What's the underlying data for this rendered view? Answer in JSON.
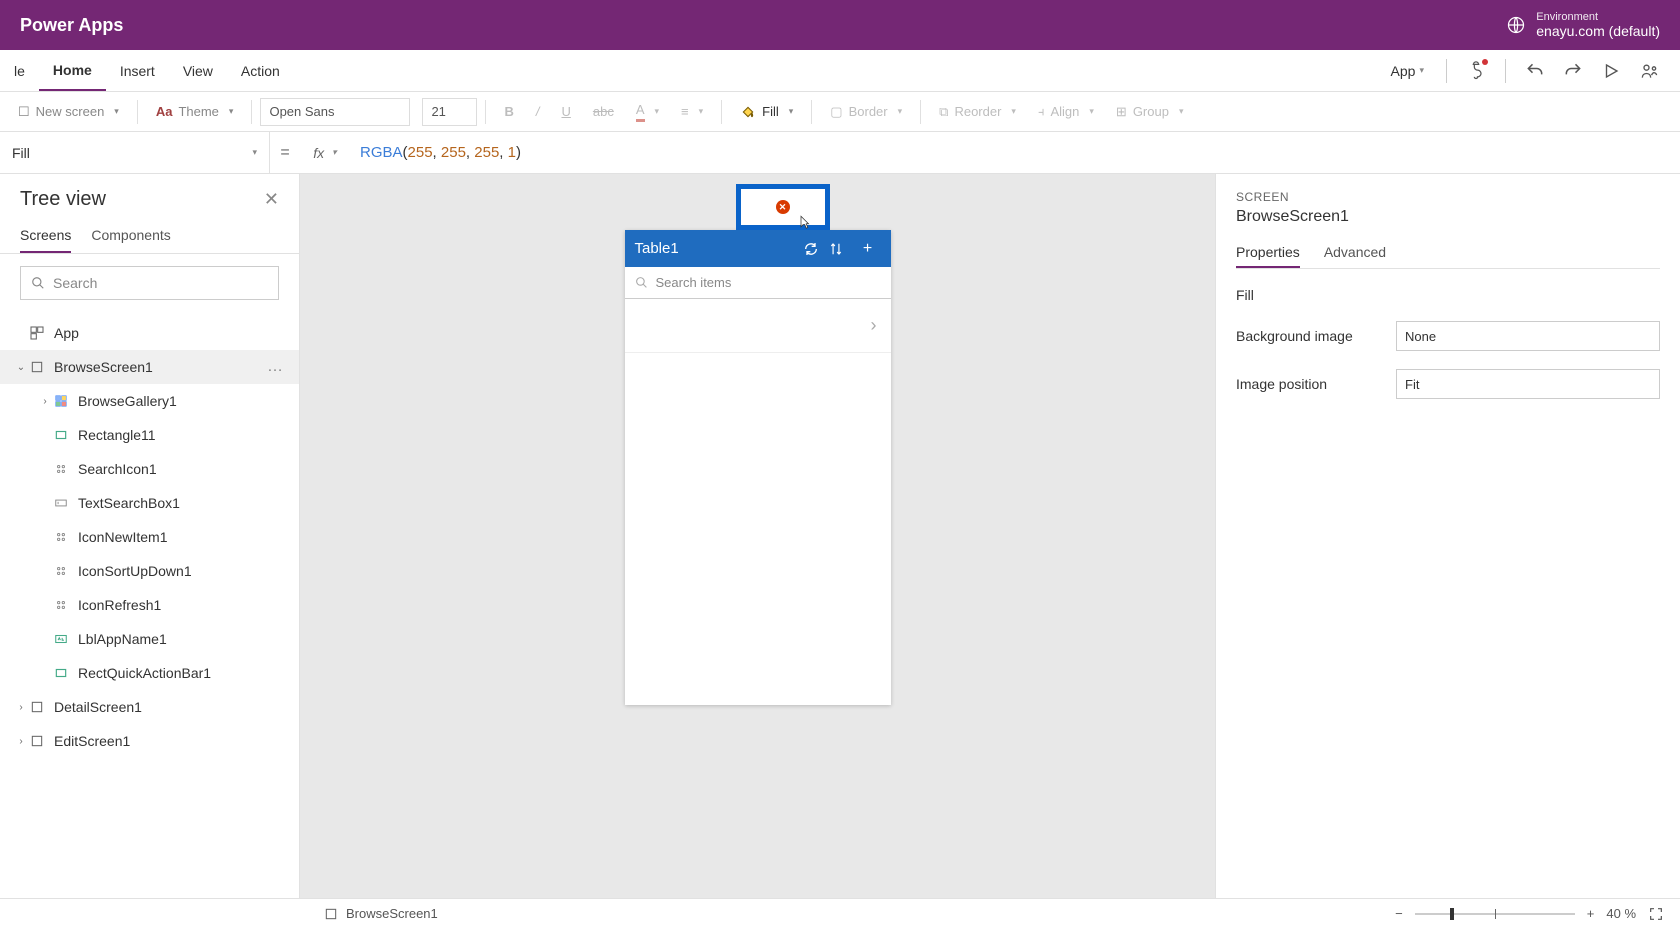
{
  "header": {
    "app_name": "Power Apps",
    "env_label": "Environment",
    "env_value": "enayu.com (default)"
  },
  "menu": {
    "items": [
      {
        "label": "le",
        "active": false,
        "cut": true
      },
      {
        "label": "Home",
        "active": true
      },
      {
        "label": "Insert",
        "active": false
      },
      {
        "label": "View",
        "active": false
      },
      {
        "label": "Action",
        "active": false
      }
    ],
    "app_label": "App"
  },
  "toolbar": {
    "new_screen": "New screen",
    "theme": "Theme",
    "font_name": "Open Sans",
    "font_size": "21",
    "fill": "Fill",
    "border": "Border",
    "reorder": "Reorder",
    "align": "Align",
    "group": "Group"
  },
  "formula": {
    "property": "Fill",
    "fx": "fx",
    "value_fn": "RGBA",
    "value_args": [
      "255",
      "255",
      "255",
      "1"
    ]
  },
  "tree_view": {
    "title": "Tree view",
    "tabs": [
      "Screens",
      "Components"
    ],
    "active_tab": 0,
    "search_placeholder": "Search",
    "nodes": [
      {
        "label": "App",
        "level": 0,
        "icon": "app",
        "caret": ""
      },
      {
        "label": "BrowseScreen1",
        "level": 0,
        "icon": "screen",
        "caret": "down",
        "selected": true,
        "more": true
      },
      {
        "label": "BrowseGallery1",
        "level": 1,
        "icon": "gallery",
        "caret": "right"
      },
      {
        "label": "Rectangle11",
        "level": 1,
        "icon": "rect",
        "caret": ""
      },
      {
        "label": "SearchIcon1",
        "level": 1,
        "icon": "icon",
        "caret": ""
      },
      {
        "label": "TextSearchBox1",
        "level": 1,
        "icon": "textbox",
        "caret": ""
      },
      {
        "label": "IconNewItem1",
        "level": 1,
        "icon": "icon",
        "caret": ""
      },
      {
        "label": "IconSortUpDown1",
        "level": 1,
        "icon": "icon",
        "caret": ""
      },
      {
        "label": "IconRefresh1",
        "level": 1,
        "icon": "icon",
        "caret": ""
      },
      {
        "label": "LblAppName1",
        "level": 1,
        "icon": "label",
        "caret": ""
      },
      {
        "label": "RectQuickActionBar1",
        "level": 1,
        "icon": "rect",
        "caret": ""
      },
      {
        "label": "DetailScreen1",
        "level": 0,
        "icon": "screen",
        "caret": "right"
      },
      {
        "label": "EditScreen1",
        "level": 0,
        "icon": "screen",
        "caret": "right"
      }
    ]
  },
  "canvas": {
    "app_bar_title": "Table1",
    "search_placeholder": "Search items"
  },
  "right_panel": {
    "section_label": "SCREEN",
    "title": "BrowseScreen1",
    "tabs": [
      "Properties",
      "Advanced"
    ],
    "active_tab": 0,
    "props": [
      {
        "label": "Fill",
        "value": ""
      },
      {
        "label": "Background image",
        "value": "None"
      },
      {
        "label": "Image position",
        "value": "Fit"
      }
    ]
  },
  "status_bar": {
    "screen_name": "BrowseScreen1",
    "zoom_pct": "40",
    "pct_symbol": "%"
  }
}
